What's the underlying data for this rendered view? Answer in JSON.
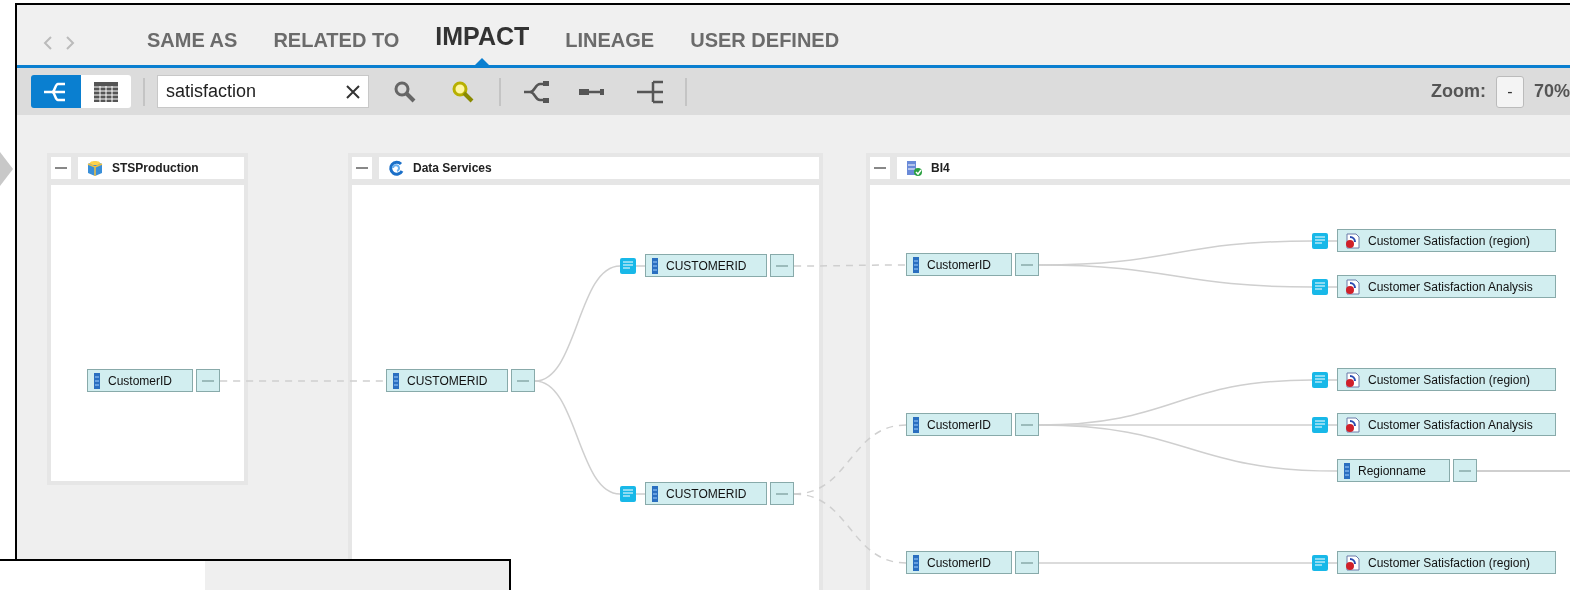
{
  "tabs": [
    {
      "label": "SAME AS",
      "selected": false
    },
    {
      "label": "RELATED TO",
      "selected": false
    },
    {
      "label": "IMPACT",
      "selected": true
    },
    {
      "label": "LINEAGE",
      "selected": false
    },
    {
      "label": "USER DEFINED",
      "selected": false
    }
  ],
  "toolbar": {
    "view_modes": [
      {
        "kind": "graph",
        "selected": true
      },
      {
        "kind": "table",
        "selected": false
      }
    ],
    "search": {
      "value": "satisfaction"
    },
    "zoom": {
      "label": "Zoom:",
      "button": "-",
      "value": "70%"
    }
  },
  "panels": [
    {
      "title": "STSProduction",
      "kind": "database"
    },
    {
      "title": "Data Services",
      "kind": "service"
    },
    {
      "title": "BI4",
      "kind": "server"
    }
  ],
  "tree": {
    "label": "CustomerID",
    "kind": "column",
    "flagged": false,
    "children": [
      {
        "label": "CUSTOMERID",
        "kind": "column",
        "flagged": false,
        "children": [
          {
            "label": "CUSTOMERID",
            "kind": "column",
            "flagged": true,
            "children": [
              {
                "label": "CustomerID",
                "kind": "column",
                "flagged": false,
                "children": [
                  {
                    "label": "Customer Satisfaction (region)",
                    "kind": "report",
                    "flagged": true
                  },
                  {
                    "label": "Customer Satisfaction Analysis",
                    "kind": "report",
                    "flagged": true
                  }
                ]
              }
            ]
          },
          {
            "label": "CUSTOMERID",
            "kind": "column",
            "flagged": true,
            "children": [
              {
                "label": "CustomerID",
                "kind": "column",
                "flagged": false,
                "children": [
                  {
                    "label": "Customer Satisfaction (region)",
                    "kind": "report",
                    "flagged": true
                  },
                  {
                    "label": "Customer Satisfaction Analysis",
                    "kind": "report",
                    "flagged": true
                  },
                  {
                    "label": "Regionname",
                    "kind": "column",
                    "flagged": false,
                    "continues": true
                  }
                ]
              },
              {
                "label": "CustomerID",
                "kind": "column",
                "flagged": false,
                "children": [
                  {
                    "label": "Customer Satisfaction (region)",
                    "kind": "report",
                    "flagged": true
                  }
                ]
              }
            ]
          }
        ]
      }
    ]
  }
}
